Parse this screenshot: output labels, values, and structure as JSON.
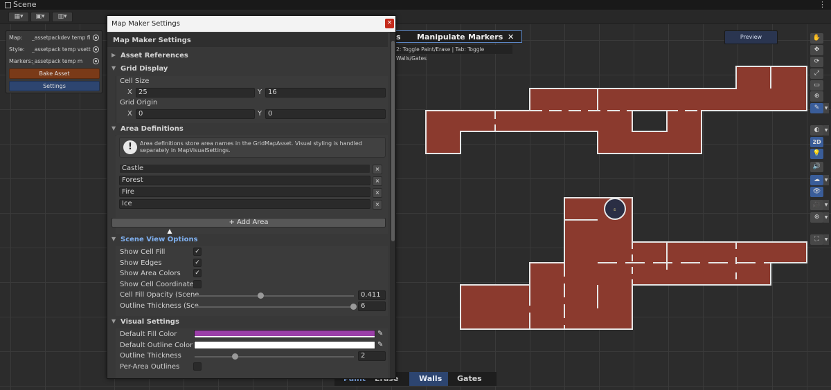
{
  "window_tab": {
    "title": "Scene",
    "more": "⋮"
  },
  "toolbar": {
    "btn1": "▦▾",
    "btn2": "▣▾",
    "btn3": "▥▾"
  },
  "map_panel": {
    "rows": [
      {
        "label": "Map:",
        "value": "_assetpackdev temp fi"
      },
      {
        "label": "Style:",
        "value": "_assetpack temp vsett"
      },
      {
        "label": "Markers:",
        "value": "_assetpack temp m"
      }
    ],
    "bake": "Bake Asset",
    "settings": "Settings"
  },
  "settings_window": {
    "title": "Map Maker Settings",
    "close": "×",
    "header": "Map Maker Settings",
    "asset_refs": "Asset References",
    "grid_display": "Grid Display",
    "cell_size": "Cell Size",
    "x_label": "X",
    "y_label": "Y",
    "cell_size_x": "25",
    "cell_size_y": "16",
    "grid_origin": "Grid Origin",
    "grid_origin_x": "0",
    "grid_origin_y": "0",
    "area_definitions": "Area Definitions",
    "info": "Area definitions store area names in the GridMapAsset. Visual styling is handled separately in MapVisualSettings.",
    "areas": [
      "Castle",
      "Forest",
      "Fire",
      "Ice"
    ],
    "remove": "×",
    "add_area": "+ Add Area",
    "scene_view_options": "Scene View Options",
    "show_cell_fill": "Show Cell Fill",
    "show_edges": "Show Edges",
    "show_area_colors": "Show Area Colors",
    "show_cell_coords": "Show Cell Coordinates",
    "cell_fill_opacity": "Cell Fill Opacity (Scene",
    "cell_fill_opacity_value": "0.411",
    "outline_thickness_scene": "Outline Thickness (Sce",
    "outline_thickness_scene_value": "6",
    "visual_settings": "Visual Settings",
    "default_fill": "Default Fill Color",
    "default_outline": "Default Outline Color",
    "outline_thickness": "Outline Thickness",
    "outline_thickness_value": "2",
    "per_area_outlines": "Per-Area Outlines",
    "check": "✓"
  },
  "scene_overlay": {
    "tabs": [
      "s",
      "Manipulate",
      "Markers"
    ],
    "close": "✕",
    "hint": "2: Toggle Paint/Erase | Tab: Toggle Walls/Gates",
    "preview": "Preview",
    "mode": [
      "Paint",
      "Erase",
      "Walls",
      "Gates"
    ],
    "marker_label": "s"
  },
  "right_tools": [
    "✋",
    "✥",
    "⟳",
    "⤢",
    "▭",
    "⊕",
    "✎",
    "◐",
    "2D",
    "💡",
    "🔊",
    "☁",
    "👁",
    "🎥",
    "⊛",
    "⛶"
  ],
  "colors": {
    "room_fill": "#8b3a2e",
    "wall": "#e6e6e6",
    "fill_color": "#9b3fa8",
    "accent": "#3a5d99"
  }
}
